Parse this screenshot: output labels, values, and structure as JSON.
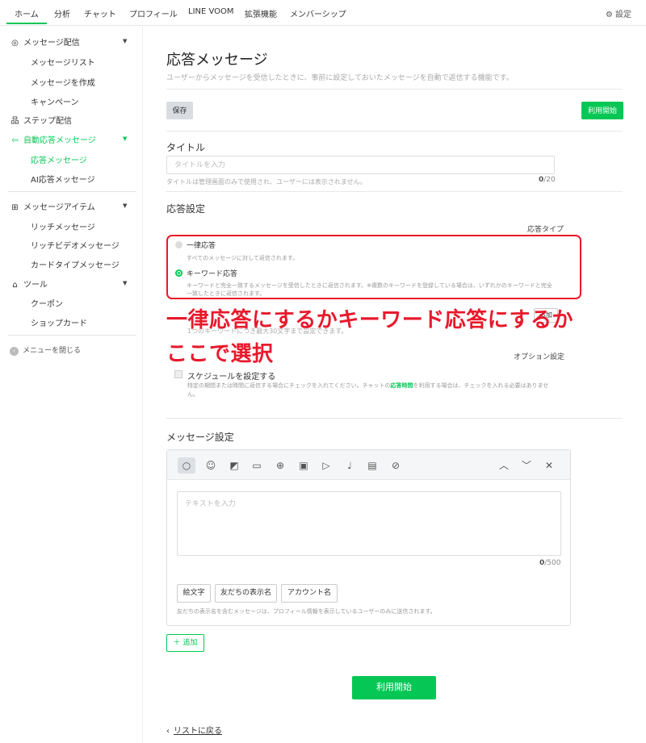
{
  "topnav": {
    "tabs": [
      "ホーム",
      "分析",
      "チャット",
      "プロフィール",
      "LINE VOOM",
      "拡張機能",
      "メンバーシップ"
    ],
    "settings": "設定"
  },
  "sidebar": {
    "message_delivery": "メッセージ配信",
    "message_list": "メッセージリスト",
    "create_message": "メッセージを作成",
    "campaign": "キャンペーン",
    "step_delivery": "ステップ配信",
    "auto_reply": "自動応答メッセージ",
    "reply_message": "応答メッセージ",
    "ai_reply": "AI応答メッセージ",
    "message_items": "メッセージアイテム",
    "rich_message": "リッチメッセージ",
    "rich_video": "リッチビデオメッセージ",
    "card_type": "カードタイプメッセージ",
    "tools": "ツール",
    "coupon": "クーポン",
    "shop_card": "ショップカード",
    "close_menu": "メニューを閉じる"
  },
  "main": {
    "title": "応答メッセージ",
    "description": "ユーザーからメッセージを受信したときに、事前に設定しておいたメッセージを自動で返信する機能です。",
    "save_label": "保存",
    "start_label": "利用開始",
    "title_section": "タイトル",
    "title_placeholder": "タイトルを入力",
    "title_hint": "タイトルは管理画面のみで使用され、ユーザーには表示されません。",
    "title_count": "0",
    "title_max": "/20",
    "reply_settings": "応答設定",
    "reply_type": "応答タイプ",
    "option_uniform": "一律応答",
    "option_uniform_desc": "すべてのメッセージに対して返信されます。",
    "option_keyword": "キーワード応答",
    "option_keyword_desc_1": "キーワードと完全一致するメッセージを受信したときに返信されます。※複数のキーワードを登録している場合は、いずれかのキーワードと完全",
    "option_keyword_desc_2": "一致したときに返信されます。",
    "keyword_hint": "1つのキーワードにつき最大30文字まで設定できます。",
    "keyword_add": "追加",
    "annotation_line1": "一律応答にするかキーワード応答にするか",
    "annotation_line2": "ここで選択",
    "option_settings": "オプション設定",
    "schedule_label": "スケジュールを設定する",
    "schedule_desc_1": "特定の期間または時間に返信する場合にチェックを入れてください。チャットの",
    "schedule_desc_link": "応答時間",
    "schedule_desc_2": "を利用する場合は、チェックを入れる必要はありませ",
    "schedule_desc_3": "ん。",
    "message_settings": "メッセージ設定",
    "text_placeholder": "テキストを入力",
    "text_count": "0",
    "text_max": "/500",
    "emoji_btn": "絵文字",
    "friend_name_btn": "友だちの表示名",
    "account_name_btn": "アカウント名",
    "editor_hint": "友だちの表示名を含むメッセージは、プロフィール情報を表示しているユーザーのみに送信されます。",
    "add_label": "追加",
    "start_bottom": "利用開始",
    "back": "リストに戻る"
  },
  "icons": {
    "toolbar": [
      "speech-bubble-icon",
      "smiley-icon",
      "sticker-icon",
      "image-icon",
      "coupon-icon",
      "video-icon",
      "play-icon",
      "mic-icon",
      "card-icon",
      "compass-icon"
    ],
    "controls": [
      "chevron-up-icon",
      "chevron-down-icon",
      "close-icon"
    ]
  },
  "colors": {
    "accent": "#06c755",
    "annotation": "#e8192c"
  }
}
